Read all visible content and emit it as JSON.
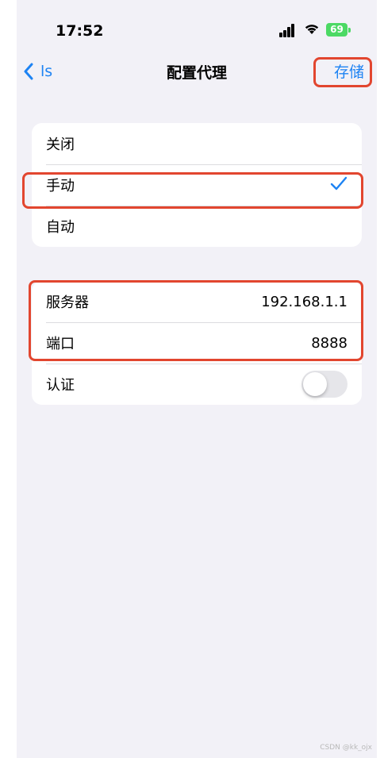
{
  "status_bar": {
    "time": "17:52",
    "battery": "69",
    "icons": [
      "signal-bars-icon",
      "wifi-icon",
      "battery-charging-icon"
    ]
  },
  "nav": {
    "back_label": "ls",
    "title": "配置代理",
    "save_label": "存储"
  },
  "proxy_modes": [
    {
      "label": "关闭",
      "selected": false
    },
    {
      "label": "手动",
      "selected": true
    },
    {
      "label": "自动",
      "selected": false
    }
  ],
  "manual_settings": {
    "server_label": "服务器",
    "server_value": "192.168.1.1",
    "port_label": "端口",
    "port_value": "8888",
    "auth_label": "认证",
    "auth_enabled": false
  },
  "watermark": "CSDN @kk_ojx",
  "colors": {
    "accent": "#1d83f3",
    "highlight": "#e2462f",
    "background": "#f2f1f7"
  }
}
